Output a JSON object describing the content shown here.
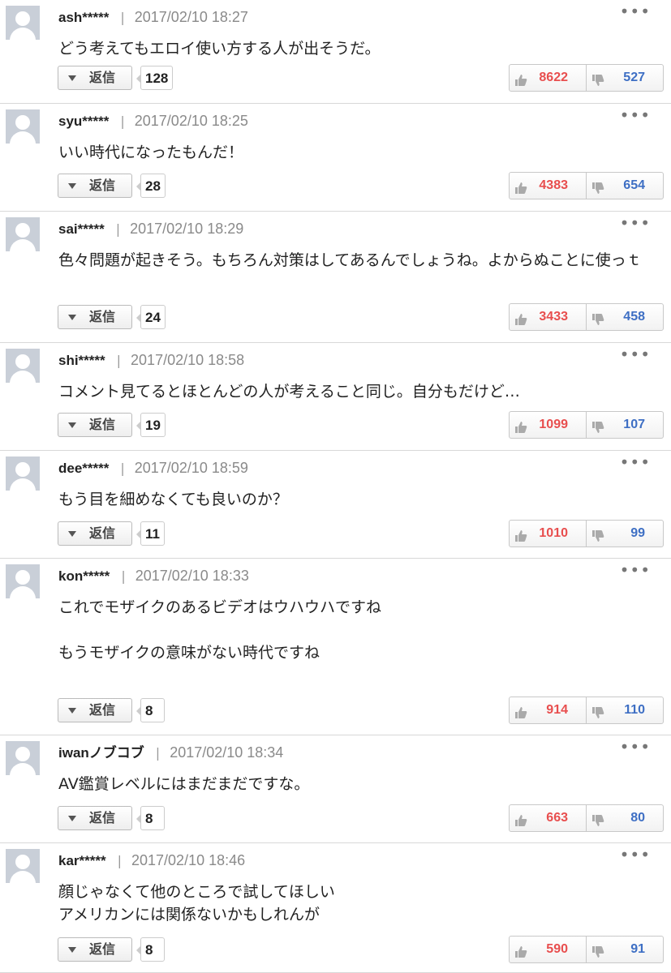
{
  "reply_label": "返信",
  "more_label": "•••",
  "separator": "|",
  "comments": [
    {
      "user": "ash*****",
      "time": "2017/02/10 18:27",
      "text": "どう考えてもエロイ使い方する人が出そうだ。",
      "replies": "128",
      "good": "8622",
      "bad": "527"
    },
    {
      "user": "syu*****",
      "time": "2017/02/10 18:25",
      "text": "いい時代になったもんだ！",
      "replies": "28",
      "good": "4383",
      "bad": "654"
    },
    {
      "user": "sai*****",
      "time": "2017/02/10 18:29",
      "text": "色々問題が起きそう。もちろん対策はしてあるんでしょうね。よからぬことに使っｔ",
      "replies": "24",
      "good": "3433",
      "bad": "458"
    },
    {
      "user": "shi*****",
      "time": "2017/02/10 18:58",
      "text": "コメント見てるとほとんどの人が考えること同じ。自分もだけど…",
      "replies": "19",
      "good": "1099",
      "bad": "107"
    },
    {
      "user": "dee*****",
      "time": "2017/02/10 18:59",
      "text": "もう目を細めなくても良いのか？",
      "replies": "11",
      "good": "1010",
      "bad": "99"
    },
    {
      "user": "kon*****",
      "time": "2017/02/10 18:33",
      "text": "これでモザイクのあるビデオはウハウハですね\n\nもうモザイクの意味がない時代ですね",
      "replies": "8",
      "good": "914",
      "bad": "110"
    },
    {
      "user": "iwanノブコブ",
      "time": "2017/02/10 18:34",
      "text": "AV鑑賞レベルにはまだまだですな。",
      "replies": "8",
      "good": "663",
      "bad": "80"
    },
    {
      "user": "kar*****",
      "time": "2017/02/10 18:46",
      "text": "顔じゃなくて他のところで試してほしい\nアメリカンには関係ないかもしれんが",
      "replies": "8",
      "good": "590",
      "bad": "91"
    }
  ],
  "colors": {
    "good": "#e84e4e",
    "bad": "#3e6fc4",
    "avatar": "#c9cfd8"
  },
  "icons": {
    "avatar": "default-user-avatar",
    "good": "thumbs-up-icon",
    "bad": "thumbs-down-icon",
    "more": "more-dots-icon",
    "reply": "triangle-down-icon"
  }
}
